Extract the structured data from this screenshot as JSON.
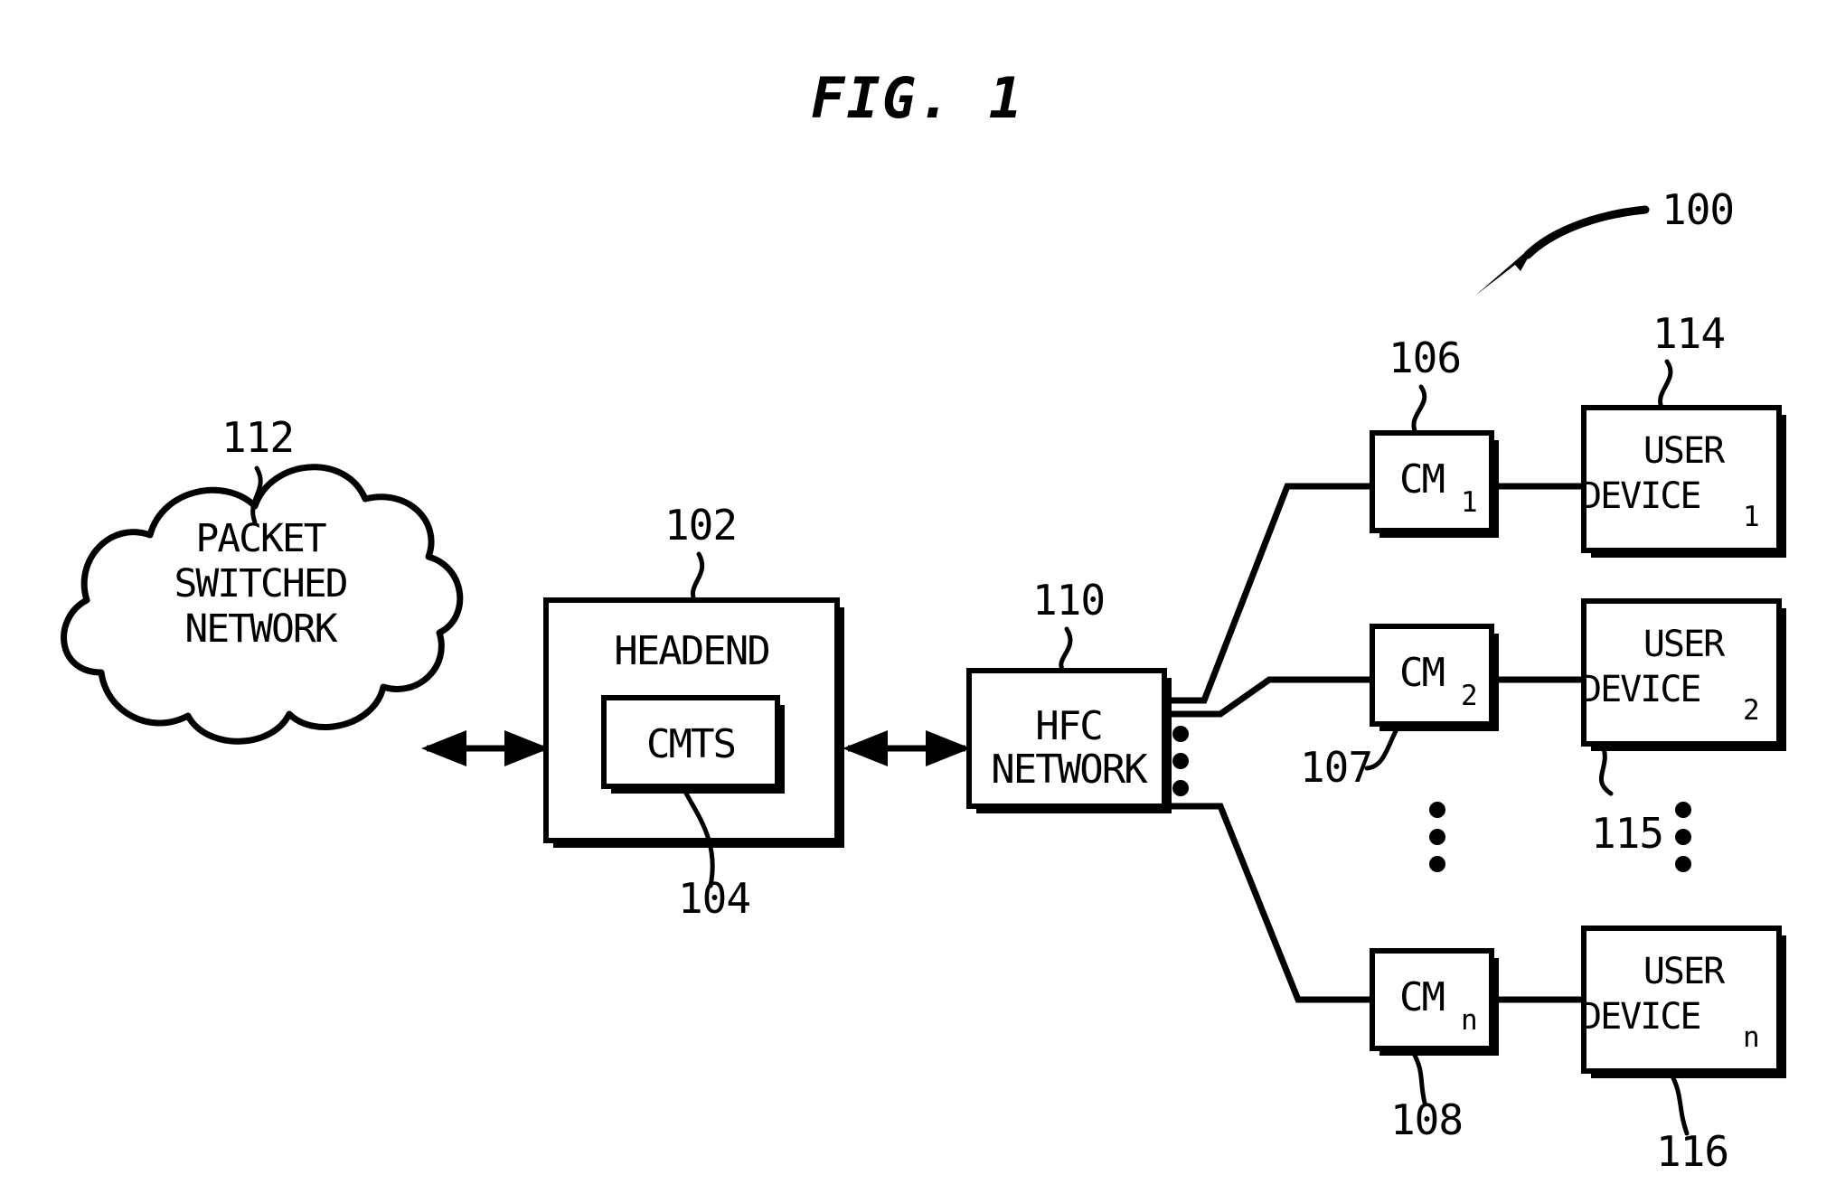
{
  "figure": {
    "title": "FIG. 1",
    "system_ref": "100"
  },
  "cloud": {
    "ref": "112",
    "line1": "PACKET",
    "line2": "SWITCHED",
    "line3": "NETWORK"
  },
  "headend": {
    "ref": "102",
    "label": "HEADEND",
    "cmts": {
      "ref": "104",
      "label": "CMTS"
    }
  },
  "hfc": {
    "ref": "110",
    "line1": "HFC",
    "line2": "NETWORK"
  },
  "modems": [
    {
      "ref": "106",
      "label": "CM",
      "sub": "1"
    },
    {
      "ref": "107",
      "label": "CM",
      "sub": "2"
    },
    {
      "ref": "108",
      "label": "CM",
      "sub": "n"
    }
  ],
  "user_devices": [
    {
      "ref": "114",
      "line1": "USER",
      "line2": "DEVICE",
      "sub": "1"
    },
    {
      "ref": "115",
      "line1": "USER",
      "line2": "DEVICE",
      "sub": "2"
    },
    {
      "ref": "116",
      "line1": "USER",
      "line2": "DEVICE",
      "sub": "n"
    }
  ],
  "ellipsis": {
    "glyph": "⋮"
  },
  "colors": {
    "ink": "#000000",
    "paper": "#ffffff"
  }
}
